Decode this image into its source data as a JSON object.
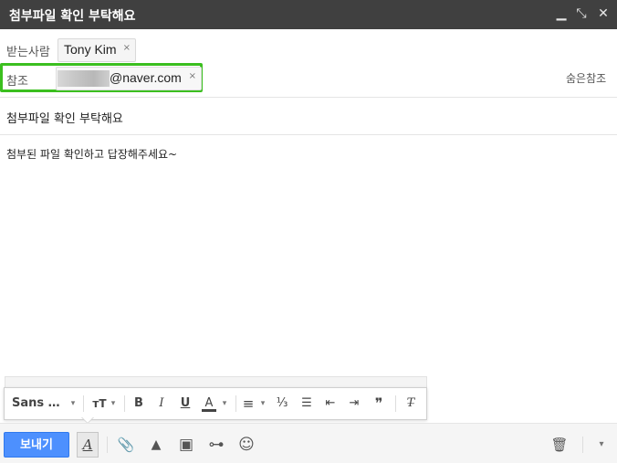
{
  "window": {
    "title": "첨부파일 확인 부탁해요",
    "minimize_glyph": "▁",
    "expand_glyph": "⤡",
    "close_glyph": "✕"
  },
  "to": {
    "label": "받는사람",
    "chip_name": "Tony Kim",
    "remove_glyph": "×"
  },
  "cc": {
    "label": "참조",
    "email": "@naver.com",
    "remove_glyph": "×",
    "bcc_link": "숨은참조"
  },
  "subject": "첨부파일 확인 부탁해요",
  "body": "첨부된 파일 확인하고 답장해주세요~",
  "format_toolbar": {
    "font_label": "Sans …",
    "dropdown_glyph": "▾",
    "size_glyph": "тT",
    "bold": "B",
    "italic": "I",
    "underline": "U",
    "text_color": "A",
    "align": "≡",
    "numbered_list": "⅓",
    "bullet_list": "☰",
    "indent_less": "⇤",
    "indent_more": "⇥",
    "quote": "❞",
    "clear_format": "T̶"
  },
  "bottom_bar": {
    "send_label": "보내기",
    "formatting_glyph": "A",
    "attach_glyph": "📎",
    "drive_glyph": "▲",
    "photo_glyph": "▣",
    "link_glyph": "⊶",
    "emoji_glyph": "☺",
    "trash_glyph": "🗑",
    "more_glyph": "▾"
  },
  "colors": {
    "title_bar": "#404040",
    "highlight": "#3bbf1f",
    "send_button": "#4d90fe"
  }
}
